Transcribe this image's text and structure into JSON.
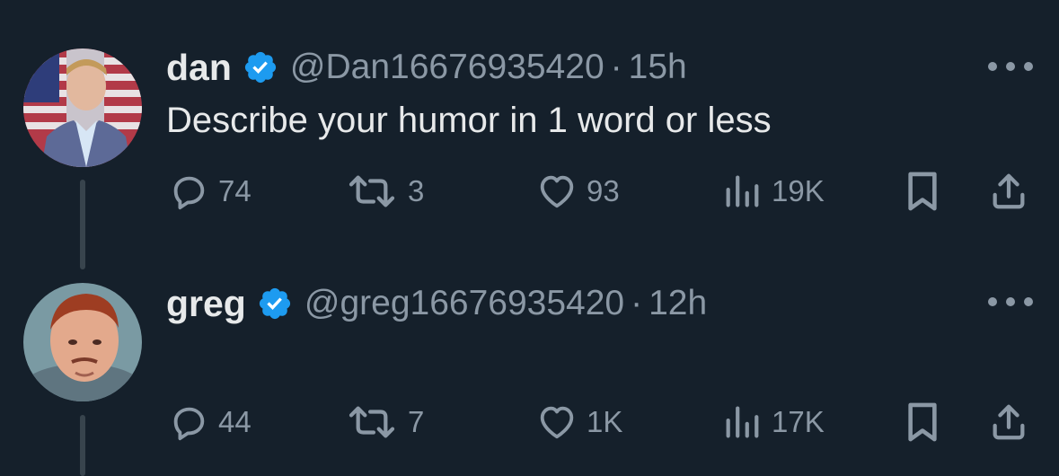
{
  "colors": {
    "background": "#15202b",
    "primary_text": "#e7e9ea",
    "secondary_text": "#8b98a5",
    "verified_blue": "#1d9bf0",
    "thread_line": "#38444d"
  },
  "tweets": [
    {
      "name": "dan",
      "handle": "@Dan16676935420",
      "separator": "·",
      "time": "15h",
      "text": "Describe your humor in 1 word or less",
      "avatar_icon": "avatar-photo",
      "verified_icon": "verified-badge-icon",
      "actions": {
        "replies": "74",
        "reposts": "3",
        "likes": "93",
        "views": "19K"
      }
    },
    {
      "name": "greg",
      "handle": "@greg16676935420",
      "separator": "·",
      "time": "12h",
      "text": "",
      "avatar_icon": "avatar-photo",
      "verified_icon": "verified-badge-icon",
      "actions": {
        "replies": "44",
        "reposts": "7",
        "likes": "1K",
        "views": "17K"
      }
    }
  ]
}
